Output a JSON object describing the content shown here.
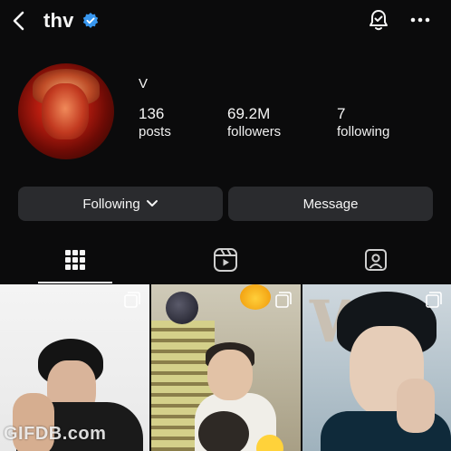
{
  "header": {
    "username": "thv",
    "back_icon": "chevron-left-icon",
    "verified_icon": "verified-badge-icon",
    "notification_icon": "bell-check-icon",
    "more_icon": "more-horizontal-icon"
  },
  "profile": {
    "display_name": "V",
    "stats": {
      "posts": {
        "value": "136",
        "label": "posts"
      },
      "followers": {
        "value": "69.2M",
        "label": "followers"
      },
      "following": {
        "value": "7",
        "label": "following"
      }
    }
  },
  "actions": {
    "following_label": "Following",
    "message_label": "Message"
  },
  "tabs": [
    {
      "name": "posts-grid",
      "icon": "grid-icon",
      "active": true
    },
    {
      "name": "reels",
      "icon": "reels-icon",
      "active": false
    },
    {
      "name": "tagged",
      "icon": "tagged-user-icon",
      "active": false
    }
  ],
  "posts": [
    {
      "type": "carousel",
      "icon": "multiple-posts-icon"
    },
    {
      "type": "carousel",
      "icon": "multiple-posts-icon"
    },
    {
      "type": "carousel",
      "icon": "multiple-posts-icon"
    }
  ],
  "watermark": "GIFDB.com",
  "colors": {
    "background": "#0b0b0c",
    "button": "#2a2b2e",
    "verified": "#3897f0"
  }
}
